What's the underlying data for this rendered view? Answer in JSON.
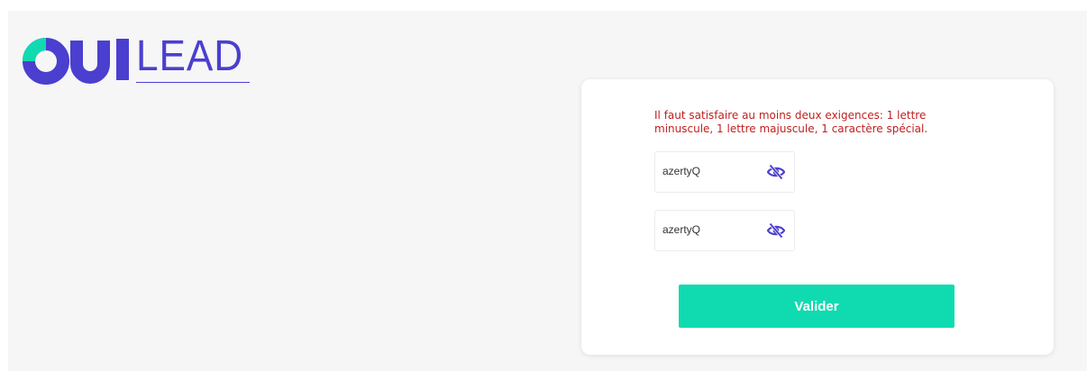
{
  "brand": {
    "logo_part1": "OUI",
    "logo_part2": "LEAD",
    "primary_color": "#4b3fcf",
    "accent_color": "#10dbb0"
  },
  "form": {
    "error_message": "Il faut satisfaire au moins deux exigences: 1 lettre minuscule, 1 lettre majuscule, 1 caractère spécial.",
    "password_value": "azertyQ",
    "confirm_password_value": "azertyQ",
    "toggle_icon": "eye-slash-icon",
    "submit_label": "Valider",
    "error_color": "#c0201e"
  }
}
